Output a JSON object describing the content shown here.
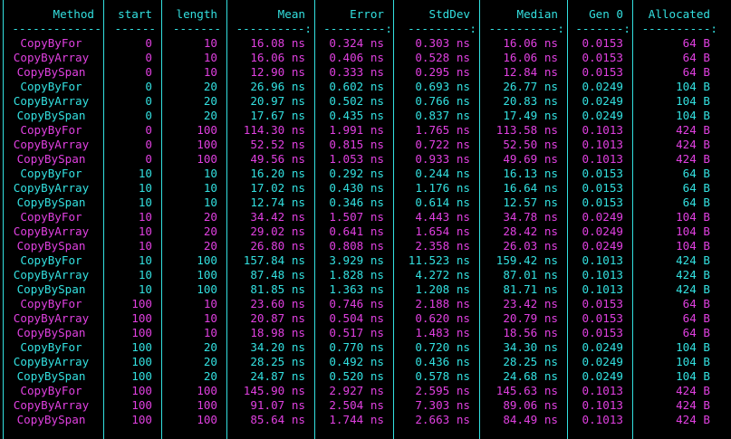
{
  "colors": {
    "cyan": "#33e0e0",
    "magenta": "#e040e0"
  },
  "headers": [
    "Method",
    "start",
    "length",
    "Mean",
    "Error",
    "StdDev",
    "Median",
    "Gen 0",
    "Allocated"
  ],
  "divider": [
    "-------------",
    "------",
    "-------",
    "----------:",
    "---------:",
    "---------:",
    "----------:",
    "-------:",
    "----------:"
  ],
  "rows": [
    {
      "color": "magenta",
      "cells": [
        "CopyByFor",
        "0",
        "10",
        "16.08 ns",
        "0.324 ns",
        "0.303 ns",
        "16.06 ns",
        "0.0153",
        "64 B"
      ]
    },
    {
      "color": "magenta",
      "cells": [
        "CopyByArray",
        "0",
        "10",
        "16.06 ns",
        "0.406 ns",
        "0.528 ns",
        "16.06 ns",
        "0.0153",
        "64 B"
      ]
    },
    {
      "color": "magenta",
      "cells": [
        "CopyBySpan",
        "0",
        "10",
        "12.90 ns",
        "0.333 ns",
        "0.295 ns",
        "12.84 ns",
        "0.0153",
        "64 B"
      ]
    },
    {
      "color": "cyan",
      "cells": [
        "CopyByFor",
        "0",
        "20",
        "26.96 ns",
        "0.602 ns",
        "0.693 ns",
        "26.77 ns",
        "0.0249",
        "104 B"
      ]
    },
    {
      "color": "cyan",
      "cells": [
        "CopyByArray",
        "0",
        "20",
        "20.97 ns",
        "0.502 ns",
        "0.766 ns",
        "20.83 ns",
        "0.0249",
        "104 B"
      ]
    },
    {
      "color": "cyan",
      "cells": [
        "CopyBySpan",
        "0",
        "20",
        "17.67 ns",
        "0.435 ns",
        "0.837 ns",
        "17.49 ns",
        "0.0249",
        "104 B"
      ]
    },
    {
      "color": "magenta",
      "cells": [
        "CopyByFor",
        "0",
        "100",
        "114.30 ns",
        "1.991 ns",
        "1.765 ns",
        "113.58 ns",
        "0.1013",
        "424 B"
      ]
    },
    {
      "color": "magenta",
      "cells": [
        "CopyByArray",
        "0",
        "100",
        "52.52 ns",
        "0.815 ns",
        "0.722 ns",
        "52.50 ns",
        "0.1013",
        "424 B"
      ]
    },
    {
      "color": "magenta",
      "cells": [
        "CopyBySpan",
        "0",
        "100",
        "49.56 ns",
        "1.053 ns",
        "0.933 ns",
        "49.69 ns",
        "0.1013",
        "424 B"
      ]
    },
    {
      "color": "cyan",
      "cells": [
        "CopyByFor",
        "10",
        "10",
        "16.20 ns",
        "0.292 ns",
        "0.244 ns",
        "16.13 ns",
        "0.0153",
        "64 B"
      ]
    },
    {
      "color": "cyan",
      "cells": [
        "CopyByArray",
        "10",
        "10",
        "17.02 ns",
        "0.430 ns",
        "1.176 ns",
        "16.64 ns",
        "0.0153",
        "64 B"
      ]
    },
    {
      "color": "cyan",
      "cells": [
        "CopyBySpan",
        "10",
        "10",
        "12.74 ns",
        "0.346 ns",
        "0.614 ns",
        "12.57 ns",
        "0.0153",
        "64 B"
      ]
    },
    {
      "color": "magenta",
      "cells": [
        "CopyByFor",
        "10",
        "20",
        "34.42 ns",
        "1.507 ns",
        "4.443 ns",
        "34.78 ns",
        "0.0249",
        "104 B"
      ]
    },
    {
      "color": "magenta",
      "cells": [
        "CopyByArray",
        "10",
        "20",
        "29.02 ns",
        "0.641 ns",
        "1.654 ns",
        "28.42 ns",
        "0.0249",
        "104 B"
      ]
    },
    {
      "color": "magenta",
      "cells": [
        "CopyBySpan",
        "10",
        "20",
        "26.80 ns",
        "0.808 ns",
        "2.358 ns",
        "26.03 ns",
        "0.0249",
        "104 B"
      ]
    },
    {
      "color": "cyan",
      "cells": [
        "CopyByFor",
        "10",
        "100",
        "157.84 ns",
        "3.929 ns",
        "11.523 ns",
        "159.42 ns",
        "0.1013",
        "424 B"
      ]
    },
    {
      "color": "cyan",
      "cells": [
        "CopyByArray",
        "10",
        "100",
        "87.48 ns",
        "1.828 ns",
        "4.272 ns",
        "87.01 ns",
        "0.1013",
        "424 B"
      ]
    },
    {
      "color": "cyan",
      "cells": [
        "CopyBySpan",
        "10",
        "100",
        "81.85 ns",
        "1.363 ns",
        "1.208 ns",
        "81.71 ns",
        "0.1013",
        "424 B"
      ]
    },
    {
      "color": "magenta",
      "cells": [
        "CopyByFor",
        "100",
        "10",
        "23.60 ns",
        "0.746 ns",
        "2.188 ns",
        "23.42 ns",
        "0.0153",
        "64 B"
      ]
    },
    {
      "color": "magenta",
      "cells": [
        "CopyByArray",
        "100",
        "10",
        "20.87 ns",
        "0.504 ns",
        "0.620 ns",
        "20.79 ns",
        "0.0153",
        "64 B"
      ]
    },
    {
      "color": "magenta",
      "cells": [
        "CopyBySpan",
        "100",
        "10",
        "18.98 ns",
        "0.517 ns",
        "1.483 ns",
        "18.56 ns",
        "0.0153",
        "64 B"
      ]
    },
    {
      "color": "cyan",
      "cells": [
        "CopyByFor",
        "100",
        "20",
        "34.20 ns",
        "0.770 ns",
        "0.720 ns",
        "34.30 ns",
        "0.0249",
        "104 B"
      ]
    },
    {
      "color": "cyan",
      "cells": [
        "CopyByArray",
        "100",
        "20",
        "28.25 ns",
        "0.492 ns",
        "0.436 ns",
        "28.25 ns",
        "0.0249",
        "104 B"
      ]
    },
    {
      "color": "cyan",
      "cells": [
        "CopyBySpan",
        "100",
        "20",
        "24.87 ns",
        "0.520 ns",
        "0.578 ns",
        "24.68 ns",
        "0.0249",
        "104 B"
      ]
    },
    {
      "color": "magenta",
      "cells": [
        "CopyByFor",
        "100",
        "100",
        "145.90 ns",
        "2.927 ns",
        "2.595 ns",
        "145.63 ns",
        "0.1013",
        "424 B"
      ]
    },
    {
      "color": "magenta",
      "cells": [
        "CopyByArray",
        "100",
        "100",
        "91.07 ns",
        "2.504 ns",
        "7.303 ns",
        "89.06 ns",
        "0.1013",
        "424 B"
      ]
    },
    {
      "color": "magenta",
      "cells": [
        "CopyBySpan",
        "100",
        "100",
        "85.64 ns",
        "1.744 ns",
        "2.663 ns",
        "84.49 ns",
        "0.1013",
        "424 B"
      ]
    }
  ]
}
